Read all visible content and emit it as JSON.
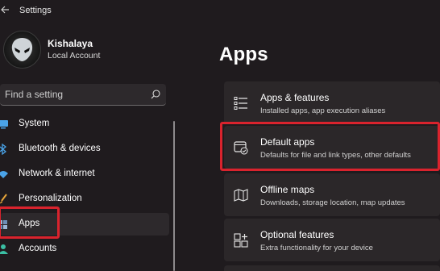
{
  "window": {
    "title": "Settings"
  },
  "user": {
    "name": "Kishalaya",
    "account_type": "Local Account"
  },
  "search": {
    "placeholder": "Find a setting"
  },
  "nav": {
    "items": [
      {
        "label": "System",
        "icon": "monitor-icon"
      },
      {
        "label": "Bluetooth & devices",
        "icon": "bluetooth-icon"
      },
      {
        "label": "Network & internet",
        "icon": "wifi-icon"
      },
      {
        "label": "Personalization",
        "icon": "brush-icon"
      },
      {
        "label": "Apps",
        "icon": "apps-icon",
        "selected": true
      },
      {
        "label": "Accounts",
        "icon": "person-icon"
      }
    ]
  },
  "main": {
    "title": "Apps",
    "cards": [
      {
        "title": "Apps & features",
        "subtitle": "Installed apps, app execution aliases",
        "icon": "list-icon"
      },
      {
        "title": "Default apps",
        "subtitle": "Defaults for file and link types, other defaults",
        "icon": "default-apps-icon"
      },
      {
        "title": "Offline maps",
        "subtitle": "Downloads, storage location, map updates",
        "icon": "map-icon"
      },
      {
        "title": "Optional features",
        "subtitle": "Extra functionality for your device",
        "icon": "add-grid-icon"
      }
    ]
  },
  "colors": {
    "accent_highlight": "#d9232d",
    "background": "#1f1b1e",
    "card": "#2b2729"
  }
}
